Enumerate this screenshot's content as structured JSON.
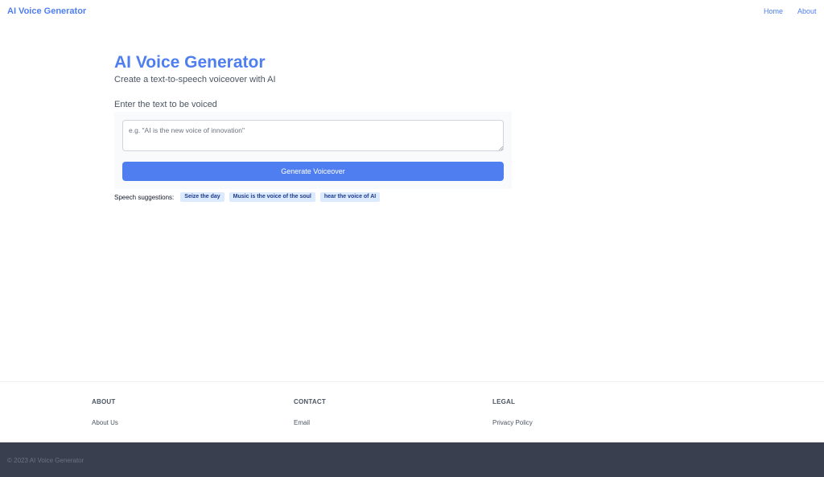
{
  "header": {
    "brand": "AI Voice Generator",
    "nav": {
      "home": "Home",
      "about": "About"
    }
  },
  "hero": {
    "title": "AI Voice Generator",
    "subtitle": "Create a text-to-speech voiceover with AI"
  },
  "form": {
    "label": "Enter the text to be voiced",
    "placeholder": "e.g. \"AI is the new voice of innovation\"",
    "value": "",
    "generate_label": "Generate Voiceover"
  },
  "suggestions": {
    "label": "Speech suggestions:",
    "items": [
      "Seize the day",
      "Music is the voice of the soul",
      "hear the voice of AI"
    ]
  },
  "footer": {
    "about": {
      "heading": "ABOUT",
      "link": "About Us"
    },
    "contact": {
      "heading": "CONTACT",
      "link": "Email"
    },
    "legal": {
      "heading": "LEGAL",
      "link": "Privacy Policy"
    },
    "copyright": "© 2023 AI Voice Generator"
  },
  "colors": {
    "accent": "#4f7ef0",
    "chip_bg": "#dbeafe",
    "footer_dark": "#393f4f"
  }
}
